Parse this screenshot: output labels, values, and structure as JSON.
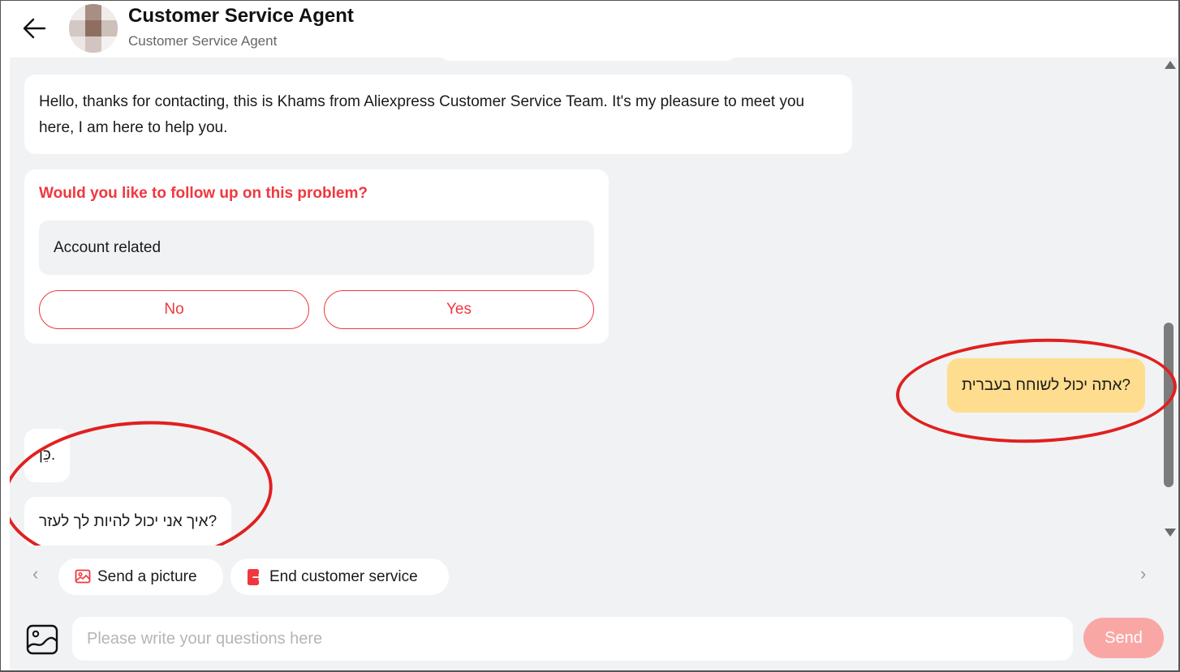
{
  "header": {
    "title": "Customer Service Agent",
    "subtitle": "Customer Service Agent"
  },
  "messages": {
    "greeting": "Hello, thanks for contacting, this is Khams from Aliexpress Customer Service Team. It's my pleasure to meet you here, I am here to help you.",
    "card": {
      "question": "Would you like to follow up on this problem?",
      "option": "Account related",
      "no_label": "No",
      "yes_label": "Yes"
    },
    "user_message": "?אתה יכול לשוחח בעברית",
    "agent_reply_1": "כֵּן.",
    "agent_reply_2": "?איך אני יכול להיות לך לעזר"
  },
  "actions": {
    "send_picture": "Send a picture",
    "end_service": "End customer service"
  },
  "composer": {
    "placeholder": "Please write your questions here",
    "send_label": "Send"
  },
  "colors": {
    "accent": "#f0373f",
    "user_bubble": "#fedd8e",
    "chat_bg": "#f1f2f4",
    "send_button": "#f9a7a5",
    "annotation_ring": "#e0201f"
  }
}
